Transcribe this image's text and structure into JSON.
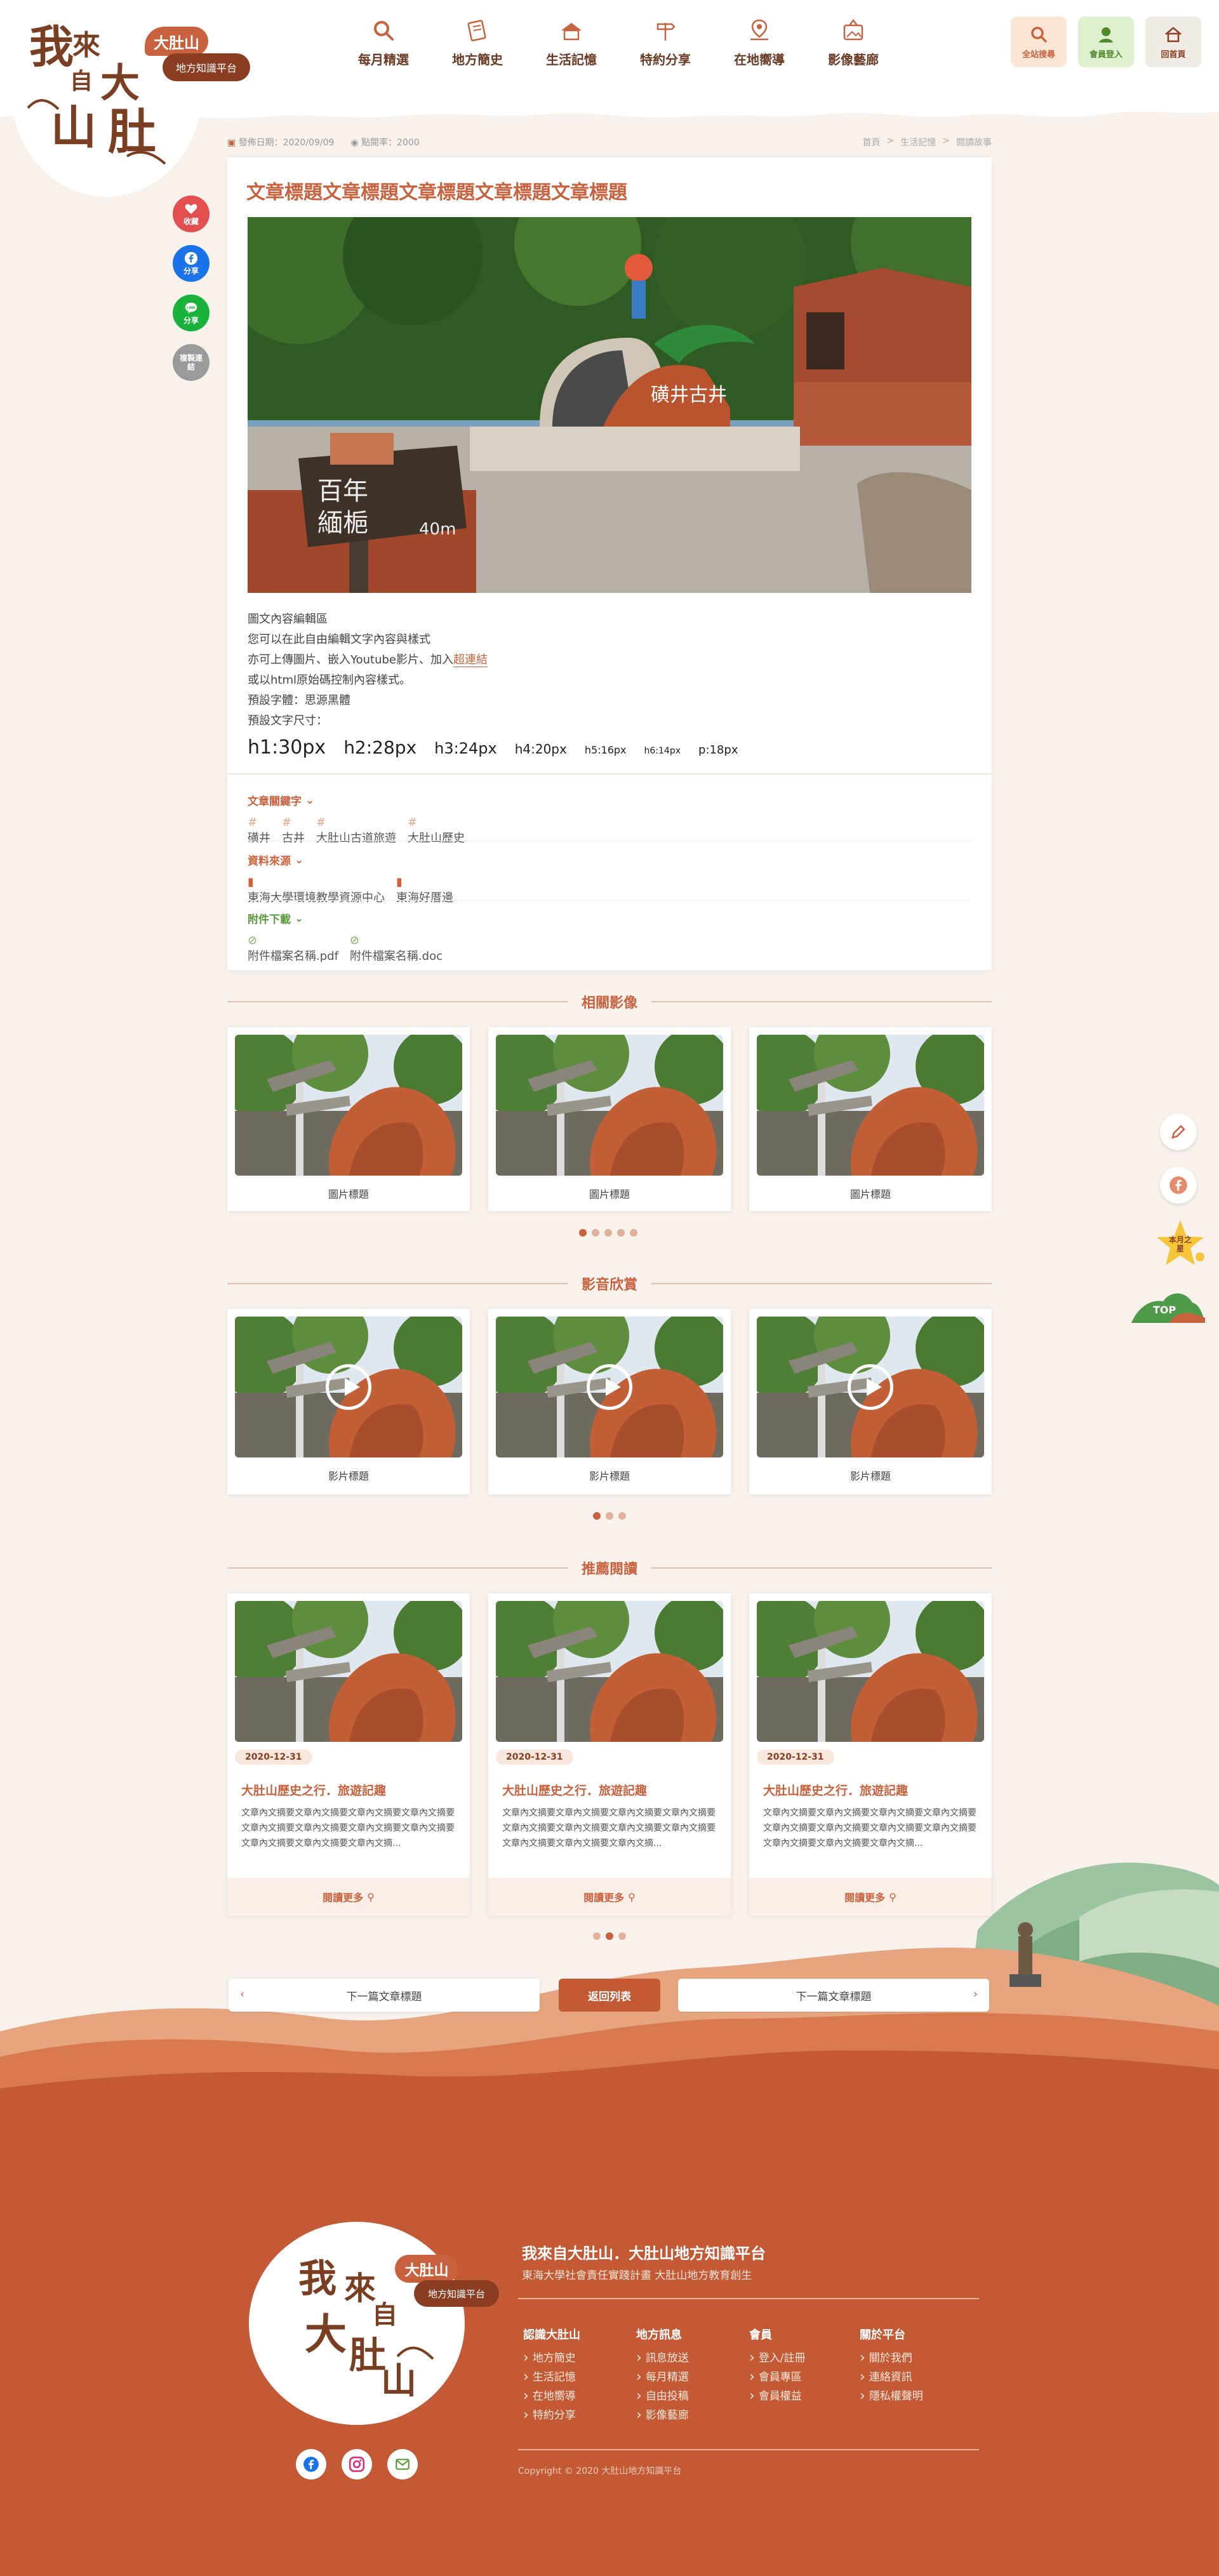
{
  "brand": {
    "logo_text": "我來自大肚山",
    "badge_a": "大肚山",
    "badge_b": "地方知識平台"
  },
  "nav": [
    {
      "label": "每月精選",
      "icon": "search-icon"
    },
    {
      "label": "地方簡史",
      "icon": "scroll-icon"
    },
    {
      "label": "生活記憶",
      "icon": "house-icon"
    },
    {
      "label": "特約分享",
      "icon": "signpost-icon"
    },
    {
      "label": "在地嚮導",
      "icon": "map-pin-icon"
    },
    {
      "label": "影像藝廊",
      "icon": "gallery-icon"
    }
  ],
  "utility": {
    "search": "全站搜尋",
    "login": "會員登入",
    "home": "回首頁"
  },
  "share": {
    "favorite": "收藏",
    "facebook": "分享",
    "line": "分享",
    "copy": "複製連結"
  },
  "right_float": {
    "moon_label": "本月之星",
    "top_label": "TOP"
  },
  "meta": {
    "date_label": "發佈日期：2020/09/09",
    "views_label": "點閱率：2000"
  },
  "breadcrumb": [
    "首頁",
    ">",
    "生活記憶",
    ">",
    "閱讀故事"
  ],
  "article": {
    "title": "文章標題文章標題文章標題文章標題文章標題",
    "lines": [
      "圖文內容編輯區",
      "您可以在此自由編輯文字內容與樣式",
      "亦可上傳圖片、嵌入Youtube影片、加入",
      "或以html原始碼控制內容樣式。",
      "預設字體：思源黑體",
      "預設文字尺寸："
    ],
    "link_text": "超連結",
    "sizes": [
      "h1:30px",
      "h2:28px",
      "h3:24px",
      "h4:20px",
      "h5:16px",
      "h6:14px",
      "p:18px"
    ],
    "photo_sign": "百年\n緬梔",
    "photo_sign_small": "40m",
    "photo_plaque": "磺井古井",
    "keywords_label": "文章關鍵字",
    "keywords": [
      "磺井",
      "古井",
      "大肚山古道旅遊",
      "大肚山歷史"
    ],
    "sources_label": "資料來源",
    "sources": [
      "東海大學環境教學資源中心",
      "東海好厝邊"
    ],
    "attachments_label": "附件下載",
    "attachments": [
      "附件檔案名稱.pdf",
      "附件檔案名稱.doc"
    ]
  },
  "related_images": {
    "title": "相關影像",
    "items": [
      "圖片標題",
      "圖片標題",
      "圖片標題"
    ]
  },
  "videos": {
    "title": "影音欣賞",
    "items": [
      "影片標題",
      "影片標題",
      "影片標題"
    ]
  },
  "recommend": {
    "title": "推薦閱讀",
    "more_label": "閱讀更多",
    "items": [
      {
        "date": "2020-12-31",
        "title": "大肚山歷史之行．旅遊記趣",
        "text": "文章內文摘要文章內文摘要文章內文摘要文章內文摘要文章內文摘要文章內文摘要文章內文摘要文章內文摘要文章內文摘要文章內文摘要文章內文摘..."
      },
      {
        "date": "2020-12-31",
        "title": "大肚山歷史之行．旅遊記趣",
        "text": "文章內文摘要文章內文摘要文章內文摘要文章內文摘要文章內文摘要文章內文摘要文章內文摘要文章內文摘要文章內文摘要文章內文摘要文章內文摘..."
      },
      {
        "date": "2020-12-31",
        "title": "大肚山歷史之行．旅遊記趣",
        "text": "文章內文摘要文章內文摘要文章內文摘要文章內文摘要文章內文摘要文章內文摘要文章內文摘要文章內文摘要文章內文摘要文章內文摘要文章內文摘..."
      }
    ]
  },
  "pager": {
    "prev": "下一篇文章標題",
    "back": "返回列表",
    "next": "下一篇文章標題"
  },
  "footer": {
    "title": "我來自大肚山．大肚山地方知識平台",
    "subtitle": "東海大學社會責任實踐計畫 大肚山地方教育創生",
    "columns": [
      {
        "heading": "認識大肚山",
        "items": [
          "地方簡史",
          "生活記憶",
          "在地嚮導",
          "特約分享"
        ]
      },
      {
        "heading": "地方訊息",
        "items": [
          "訊息放送",
          "每月精選",
          "自由投稿",
          "影像藝廊"
        ]
      },
      {
        "heading": "會員",
        "items": [
          "登入/註冊",
          "會員專區",
          "會員權益"
        ]
      },
      {
        "heading": "關於平台",
        "items": [
          "關於我們",
          "連絡資訊",
          "隱私權聲明"
        ]
      }
    ],
    "copyright": "Copyright © 2020 大肚山地方知識平台"
  },
  "colors": {
    "accent": "#c8623e",
    "dark": "#8a3d21",
    "footer_bg": "#c35a35",
    "page_bg": "#f8f1ec"
  }
}
